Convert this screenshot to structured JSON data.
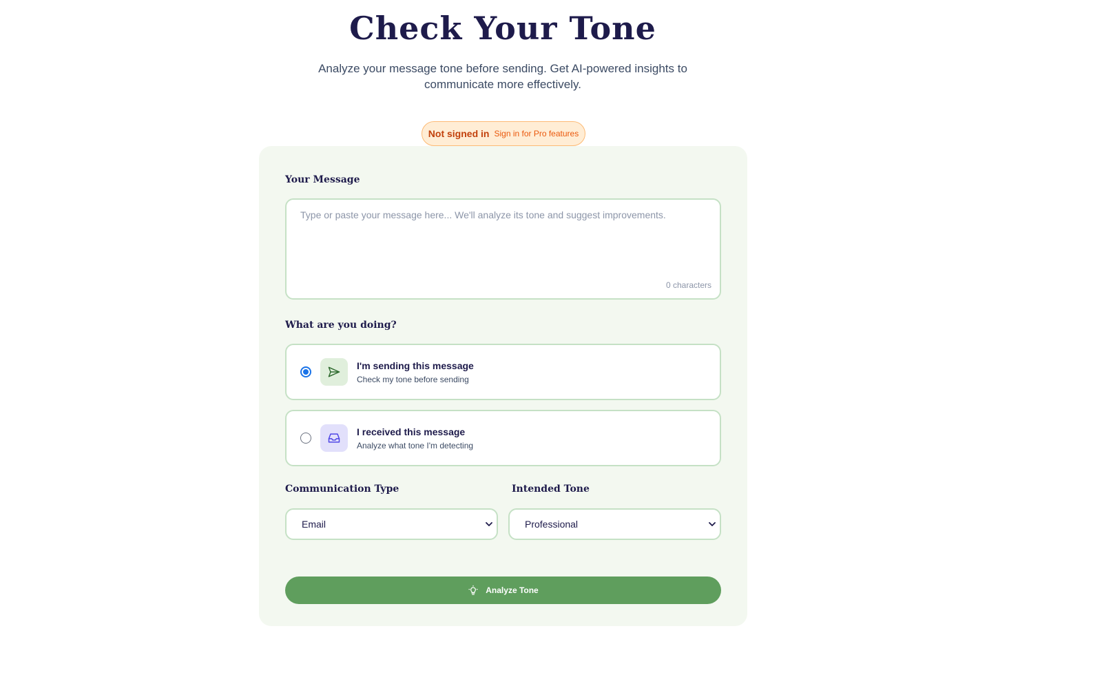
{
  "header": {
    "title": "Check Your Tone",
    "subtitle": "Analyze your message tone before sending. Get AI-powered insights to communicate more effectively."
  },
  "status": {
    "label": "Not signed in",
    "hint": "Sign in for Pro features"
  },
  "message": {
    "label": "Your Message",
    "placeholder": "Type or paste your message here... We'll analyze its tone and suggest improvements.",
    "value": "",
    "char_count": "0 characters"
  },
  "mode": {
    "label": "What are you doing?",
    "options": [
      {
        "title": "I'm sending this message",
        "description": "Check my tone before sending",
        "icon": "send-icon",
        "selected": true
      },
      {
        "title": "I received this message",
        "description": "Analyze what tone I'm detecting",
        "icon": "inbox-icon",
        "selected": false
      }
    ]
  },
  "communication_type": {
    "label": "Communication Type",
    "value": "Email"
  },
  "intended_tone": {
    "label": "Intended Tone",
    "value": "Professional"
  },
  "analyze_button": {
    "label": "Analyze Tone",
    "icon": "lightbulb-icon"
  },
  "colors": {
    "accent": "#5f9e5d",
    "card_bg": "#f3f8f0",
    "border": "#c5e1c5",
    "status_bg": "#ffedd5",
    "status_text": "#c2410c",
    "title": "#1e1b4b"
  }
}
